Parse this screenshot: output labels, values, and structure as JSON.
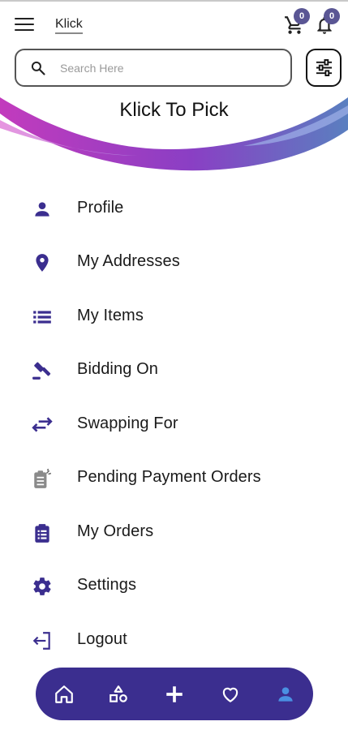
{
  "appbar": {
    "brand": "Klick",
    "cart_count": "0",
    "notification_count": "0"
  },
  "search": {
    "placeholder": "Search Here"
  },
  "banner": {
    "title": "Klick To Pick"
  },
  "menu": {
    "items": [
      {
        "label": "Profile",
        "icon": "person-icon"
      },
      {
        "label": "My Addresses",
        "icon": "location-pin-icon"
      },
      {
        "label": "My Items",
        "icon": "list-icon"
      },
      {
        "label": "Bidding On",
        "icon": "gavel-icon"
      },
      {
        "label": "Swapping For",
        "icon": "swap-arrows-icon"
      },
      {
        "label": "Pending Payment Orders",
        "icon": "pending-clipboard-icon"
      },
      {
        "label": "My Orders",
        "icon": "clipboard-list-icon"
      },
      {
        "label": "Settings",
        "icon": "gear-icon"
      },
      {
        "label": "Logout",
        "icon": "logout-icon"
      }
    ]
  },
  "bottom_nav": {
    "items": [
      "home-icon",
      "categories-icon",
      "add-icon",
      "heart-icon",
      "profile-icon"
    ],
    "active": "profile-icon"
  },
  "colors": {
    "accent": "#3b2e8f",
    "badge": "#5a5694",
    "active_nav": "#4a90e2",
    "wave_pink": "#c23bbd",
    "wave_purple": "#7a4bc7",
    "wave_blue": "#5a7fc0",
    "pending_icon": "#8a8a8a"
  }
}
